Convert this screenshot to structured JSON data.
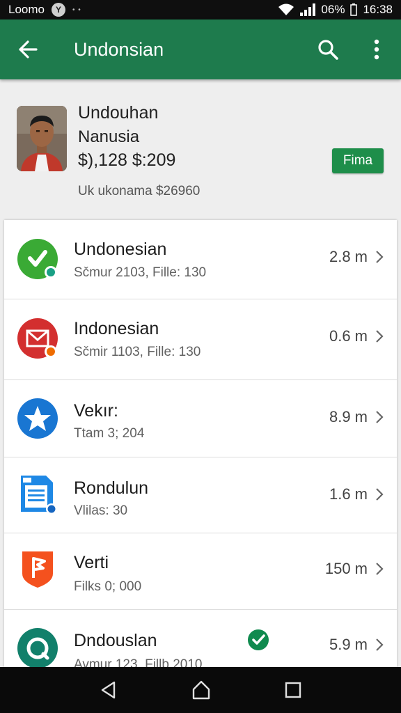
{
  "status_bar": {
    "left_text": "Loomo",
    "badge": "Y",
    "dots": "• •",
    "battery": "06%",
    "time": "16:38"
  },
  "app_bar": {
    "title": "Undonsian"
  },
  "profile": {
    "name_line1": "Undouhan",
    "name_line2": "Nanusia",
    "price": "$),128 $:209",
    "subtitle": "Uk ukonama $26960",
    "button_label": "Fima"
  },
  "items": [
    {
      "title": "Undonesian",
      "subtitle": "Sčmur 2103, Fille: 130",
      "size": "2.8 m",
      "icon": "whatsapp-icon",
      "color": "#3aaa35"
    },
    {
      "title": "Indonesian",
      "subtitle": "Sčmir 1103, Fille: 130",
      "size": "0.6 m",
      "icon": "mail-icon",
      "color": "#d32f2f"
    },
    {
      "title": "Vekır:",
      "subtitle": "Ttam 3; 204",
      "size": "8.9 m",
      "icon": "star-icon",
      "color": "#1976d2"
    },
    {
      "title": "Rondulun",
      "subtitle": "Vlilas: 30",
      "size": "1.6 m",
      "icon": "document-icon",
      "color": "#1e88e5"
    },
    {
      "title": "Verti",
      "subtitle": "Filks 0; 000",
      "size": "150 m",
      "icon": "flag-app-icon",
      "color": "#f4511e"
    },
    {
      "title": "Dndouslan",
      "subtitle": "Avmur 123, Fillb 2010",
      "size": "5.9 m",
      "icon": "chat-app-icon",
      "color": "#12806b"
    }
  ]
}
